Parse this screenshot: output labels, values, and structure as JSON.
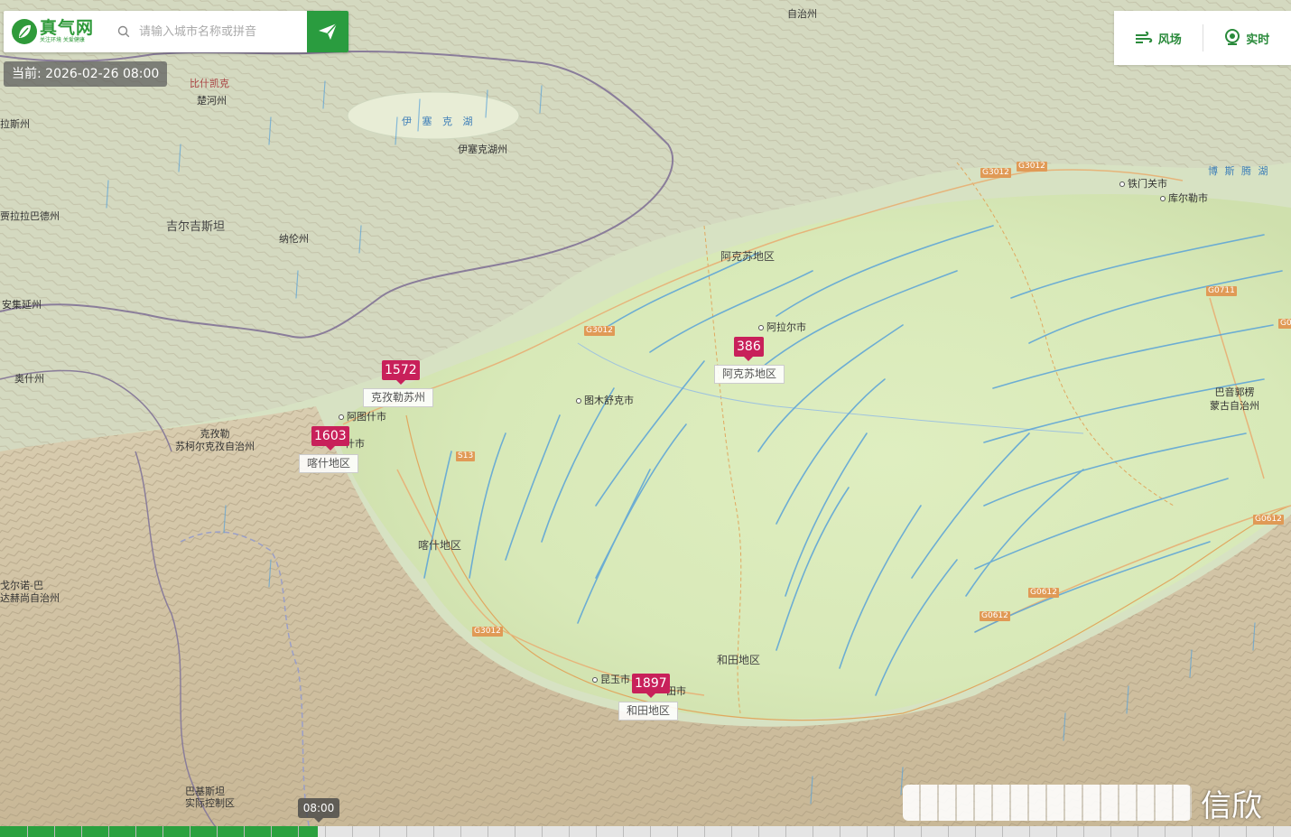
{
  "header": {
    "logo_name": "真气网",
    "logo_slogan": "关注环境 关爱健康",
    "search_placeholder": "请输入城市名称或拼音",
    "current_time_label": "当前: 2026-02-26 08:00"
  },
  "controls": {
    "wind_label": "风场",
    "realtime_label": "实时"
  },
  "markers": [
    {
      "value": "1572",
      "label": "克孜勒苏州"
    },
    {
      "value": "1603",
      "label": "喀什地区"
    },
    {
      "value": "386",
      "label": "阿克苏地区"
    },
    {
      "value": "1897",
      "label": "和田地区"
    }
  ],
  "places": {
    "bishkek": "比什凯克",
    "chuhe": "楚河州",
    "talas": "拉斯州",
    "issykkul_lake": "伊 塞 克 湖",
    "issykkul_prov": "伊塞克湖州",
    "jalalabad": "贾拉拉巴德州",
    "kyrgyzstan": "吉尔吉斯坦",
    "naryn": "纳伦州",
    "andijan": "安集延州",
    "osh": "奥什州",
    "kizilsu": "克孜勒\n苏柯尔克孜自治州",
    "artux": "阿图什市",
    "kashgar_city": "什市",
    "tumxuk": "图木舒克市",
    "aksu_pref": "阿克苏地区",
    "aral": "阿拉尔市",
    "kashgar_pref": "喀什地区",
    "hotan_pref": "和田地区",
    "kunyu": "昆玉市",
    "hotan_city": "田市",
    "tiemenguan": "铁门关市",
    "korla": "库尔勒市",
    "bosten": "博 斯 腾 湖",
    "bayingol": "巴音郭楞\n蒙古自治州",
    "gorno": "戈尔诺-巴\n达赫尚自治州",
    "kashmir": "巴基斯坦\n实际控制区",
    "top_region": "自治州"
  },
  "roads": [
    "G3012",
    "G3012",
    "G3012",
    "S13",
    "G3012",
    "G0711",
    "G0612",
    "G0612",
    "G0612",
    "G06"
  ],
  "timeline": {
    "pointer_label": "08:00"
  },
  "watermark": {
    "text": "信欣"
  }
}
